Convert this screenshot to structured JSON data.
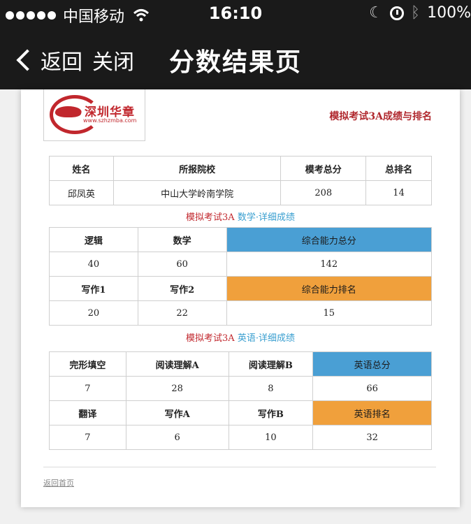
{
  "status": {
    "carrier": "中国移动",
    "time": "16:10",
    "battery": "100%"
  },
  "nav": {
    "back_label": "返回",
    "close_label": "关闭",
    "title": "分数结果页"
  },
  "logo": {
    "name": "深圳华章",
    "url": "www.szhzmba.com"
  },
  "report_title": "模拟考试3A成绩与排名",
  "summary": {
    "headers": [
      "姓名",
      "所报院校",
      "模考总分",
      "总排名"
    ],
    "values": [
      "邱凤英",
      "中山大学岭南学院",
      "208",
      "14"
    ]
  },
  "math_section": {
    "prefix": "模拟考试3A ",
    "subject": "数学·详细成绩",
    "row1_headers": [
      "逻辑",
      "数学",
      "综合能力总分"
    ],
    "row1_values": [
      "40",
      "60",
      "142"
    ],
    "row2_headers": [
      "写作1",
      "写作2",
      "综合能力排名"
    ],
    "row2_values": [
      "20",
      "22",
      "15"
    ]
  },
  "english_section": {
    "prefix": "模拟考试3A ",
    "subject": "英语·详细成绩",
    "row1_headers": [
      "完形填空",
      "阅读理解A",
      "阅读理解B",
      "英语总分"
    ],
    "row1_values": [
      "7",
      "28",
      "8",
      "66"
    ],
    "row2_headers": [
      "翻译",
      "写作A",
      "写作B",
      "英语排名"
    ],
    "row2_values": [
      "7",
      "6",
      "10",
      "32"
    ]
  },
  "footer": {
    "back_home": "返回首页"
  },
  "colors": {
    "accent_blue": "#4a9fd4",
    "accent_orange": "#f0a03c",
    "brand_red": "#c1272d"
  }
}
